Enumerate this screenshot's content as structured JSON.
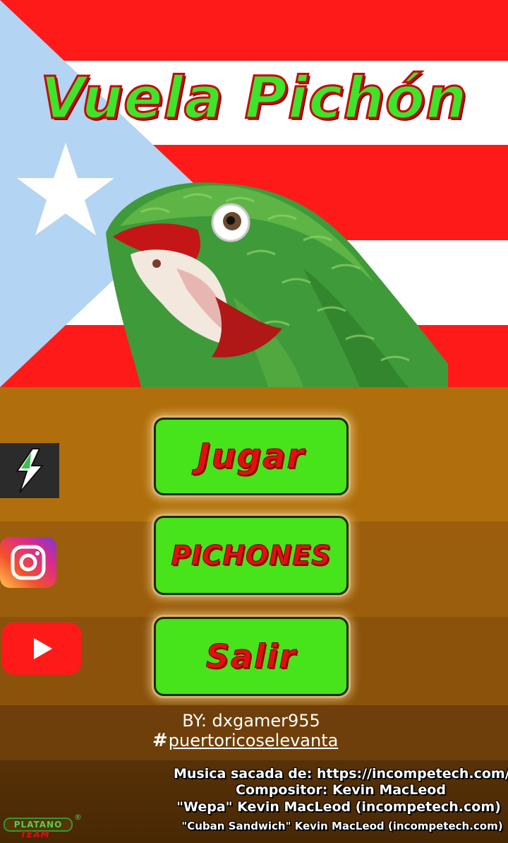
{
  "game": {
    "title": "Vuela Pichón"
  },
  "menu": {
    "play_label": "Jugar",
    "birds_label": "PICHONES",
    "exit_label": "Salir"
  },
  "social": {
    "items": [
      "power-app-icon",
      "instagram-icon",
      "youtube-icon"
    ]
  },
  "credits": {
    "author": "BY: dxgamer955",
    "hashtag_symbol": "#",
    "hashtag_text": "puertoricoselevanta",
    "music_source": "Musica sacada de: https://incompetech.com/",
    "composer": "Compositor: Kevin MacLeod",
    "track1": "\"Wepa\" Kevin MacLeod (incompetech.com)",
    "track2": "\"Cuban Sandwich\" Kevin MacLeod (incompetech.com)"
  },
  "brand": {
    "name": "PLATANO",
    "sub": "TEAM",
    "reg": "®"
  },
  "colors": {
    "flag_red": "#ff1a1a",
    "flag_blue": "#b3d4f2",
    "title_green": "#3ee42a",
    "title_outline": "#c40c0c",
    "button_green": "#47e31b",
    "button_text_red": "#e01010",
    "band_orange": "#b06f0c",
    "parrot_green": "#3f9a3a"
  }
}
